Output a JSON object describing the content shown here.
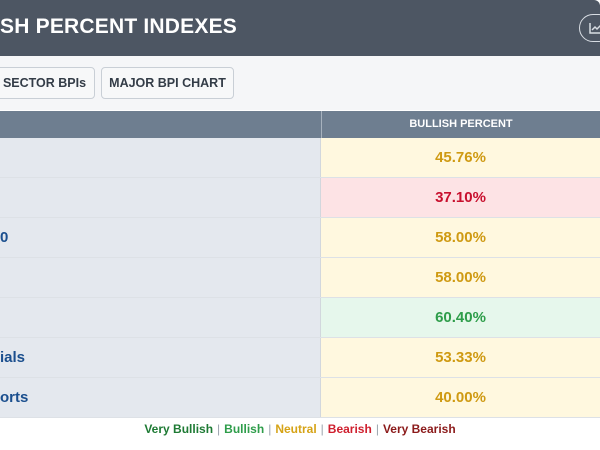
{
  "header": {
    "title": "SH PERCENT INDEXES",
    "chart_icon": "chart-icon"
  },
  "toolbar": {
    "tabs": [
      {
        "label": "SECTOR BPIs"
      },
      {
        "label": "MAJOR BPI CHART"
      }
    ]
  },
  "table": {
    "columns": {
      "value": "BULLISH PERCENT"
    },
    "rows": [
      {
        "name": "",
        "value": "45.76%",
        "sentiment": "neutral"
      },
      {
        "name": "",
        "value": "37.10%",
        "sentiment": "bearish"
      },
      {
        "name": "0",
        "value": "58.00%",
        "sentiment": "neutral"
      },
      {
        "name": "",
        "value": "58.00%",
        "sentiment": "neutral"
      },
      {
        "name": "",
        "value": "60.40%",
        "sentiment": "bullish"
      },
      {
        "name": "ials",
        "value": "53.33%",
        "sentiment": "neutral"
      },
      {
        "name": "orts",
        "value": "40.00%",
        "sentiment": "neutral"
      }
    ]
  },
  "legend": {
    "items": [
      {
        "label": "Very Bullish",
        "color": "#1e7a34"
      },
      {
        "label": "Bullish",
        "color": "#2e9d4a"
      },
      {
        "label": "Neutral",
        "color": "#d6a316"
      },
      {
        "label": "Bearish",
        "color": "#cf1f2e"
      },
      {
        "label": "Very Bearish",
        "color": "#8b1a1a"
      }
    ]
  },
  "colors": {
    "neutral_bg": "#fff8df",
    "neutral_text": "#cf9a12",
    "bearish_bg": "#fde3e5",
    "bearish_text": "#c8102e",
    "bullish_bg": "#e6f7ec",
    "bullish_text": "#2e9d4a"
  }
}
